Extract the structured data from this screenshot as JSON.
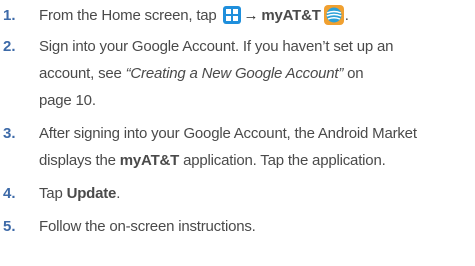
{
  "steps": [
    {
      "number": "1.",
      "lines": [
        {
          "parts": [
            {
              "text": "From the Home screen, tap ",
              "style": "normal"
            },
            {
              "icon": "apps-grid-icon"
            },
            {
              "text": "→",
              "style": "arrow"
            },
            {
              "text": "myAT&T",
              "style": "bold"
            },
            {
              "icon": "att-globe-icon"
            },
            {
              "text": ".",
              "style": "normal"
            }
          ]
        }
      ]
    },
    {
      "number": "2.",
      "lines": [
        {
          "parts": [
            {
              "text": "Sign into your Google Account. If you haven’t set up an",
              "style": "normal"
            }
          ]
        },
        {
          "parts": [
            {
              "text": "account, see ",
              "style": "normal"
            },
            {
              "text": "“Creating a New Google Account”",
              "style": "italic"
            },
            {
              "text": " on",
              "style": "normal"
            }
          ]
        },
        {
          "parts": [
            {
              "text": "page 10.",
              "style": "normal"
            }
          ]
        }
      ]
    },
    {
      "number": "3.",
      "lines": [
        {
          "parts": [
            {
              "text": "After signing into your Google Account, the Android Market",
              "style": "normal"
            }
          ]
        },
        {
          "parts": [
            {
              "text": "displays the ",
              "style": "normal"
            },
            {
              "text": "myAT&T",
              "style": "bold"
            },
            {
              "text": " application. Tap the application.",
              "style": "normal"
            }
          ]
        }
      ]
    },
    {
      "number": "4.",
      "lines": [
        {
          "parts": [
            {
              "text": "Tap ",
              "style": "normal"
            },
            {
              "text": "Update",
              "style": "bold"
            },
            {
              "text": ".",
              "style": "normal"
            }
          ]
        }
      ]
    },
    {
      "number": "5.",
      "lines": [
        {
          "parts": [
            {
              "text": "Follow the on-screen instructions.",
              "style": "normal"
            }
          ]
        }
      ]
    }
  ],
  "colors": {
    "number": "#3d6aa8",
    "text": "#4a4a4a",
    "apps_icon": "#1f8fdc"
  }
}
